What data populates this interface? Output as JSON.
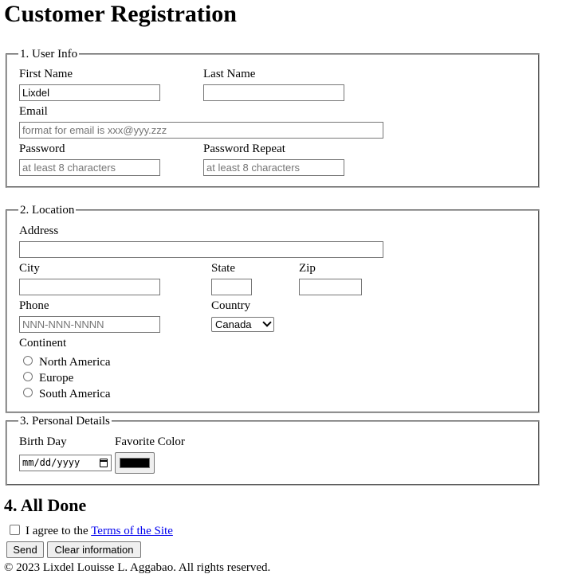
{
  "page_title": "Customer Registration",
  "section1": {
    "legend": "1. User Info",
    "first_name_label": "First Name",
    "first_name_value": "Lixdel",
    "last_name_label": "Last Name",
    "last_name_value": "",
    "email_label": "Email",
    "email_placeholder": "format for email is xxx@yyy.zzz",
    "password_label": "Password",
    "password_placeholder": "at least 8 characters",
    "password_repeat_label": "Password Repeat",
    "password_repeat_placeholder": "at least 8 characters"
  },
  "section2": {
    "legend": "2. Location",
    "address_label": "Address",
    "city_label": "City",
    "state_label": "State",
    "zip_label": "Zip",
    "phone_label": "Phone",
    "phone_placeholder": "NNN-NNN-NNNN",
    "country_label": "Country",
    "country_selected": "Canada",
    "continent_label": "Continent",
    "continents": [
      "North America",
      "Europe",
      "South America"
    ]
  },
  "section3": {
    "legend": "3. Personal Details",
    "birthday_label": "Birth Day",
    "birthday_placeholder": "mm/dd/yyyy",
    "favorite_color_label": "Favorite Color",
    "favorite_color_value": "#000000"
  },
  "section4": {
    "heading": "4. All Done",
    "agree_prefix": "I agree to the ",
    "terms_link": "Terms of the Site",
    "send_label": "Send",
    "clear_label": "Clear information"
  },
  "footer": "© 2023 Lixdel Louisse L. Aggabao. All rights reserved.",
  "icons": {
    "calendar": "calendar-icon",
    "dropdown": "chevron-down-icon"
  }
}
